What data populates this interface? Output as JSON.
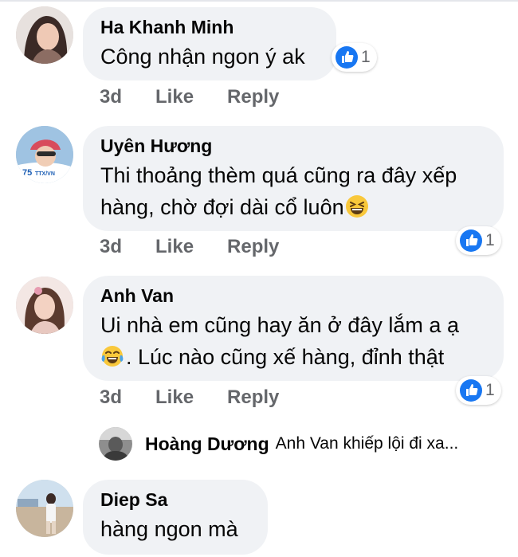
{
  "comments": [
    {
      "name": "Ha Khanh Minh",
      "text": [
        "Công nhận ngon ý ak"
      ],
      "time": "3d",
      "like": "Like",
      "reply": "Reply",
      "reactions": "1"
    },
    {
      "name": "Uyên Hương",
      "text": [
        "Thi thoảng thèm quá cũng ra đây xếp",
        "hàng, chờ đợi dài cổ luôn"
      ],
      "emoji": "grinning-squint-emoji",
      "time": "3d",
      "like": "Like",
      "reply": "Reply",
      "reactions": "1"
    },
    {
      "name": "Anh Van",
      "text": [
        "Ui nhà em cũng hay ăn ở đây lắm a ạ",
        ". Lúc nào cũng xế hàng, đỉnh thật"
      ],
      "emoji": "tears-of-joy-emoji",
      "time": "3d",
      "like": "Like",
      "reply": "Reply",
      "reactions": "1",
      "reply_preview": {
        "name": "Hoàng Dương",
        "snippet": "Anh Van khiếp lội đi xa..."
      }
    },
    {
      "name": "Diep Sa",
      "text": [
        "hàng ngon mà"
      ]
    }
  ],
  "colors": {
    "like_blue": "#1877f2",
    "bubble": "#f0f2f5",
    "meta_gray": "#65676b"
  }
}
